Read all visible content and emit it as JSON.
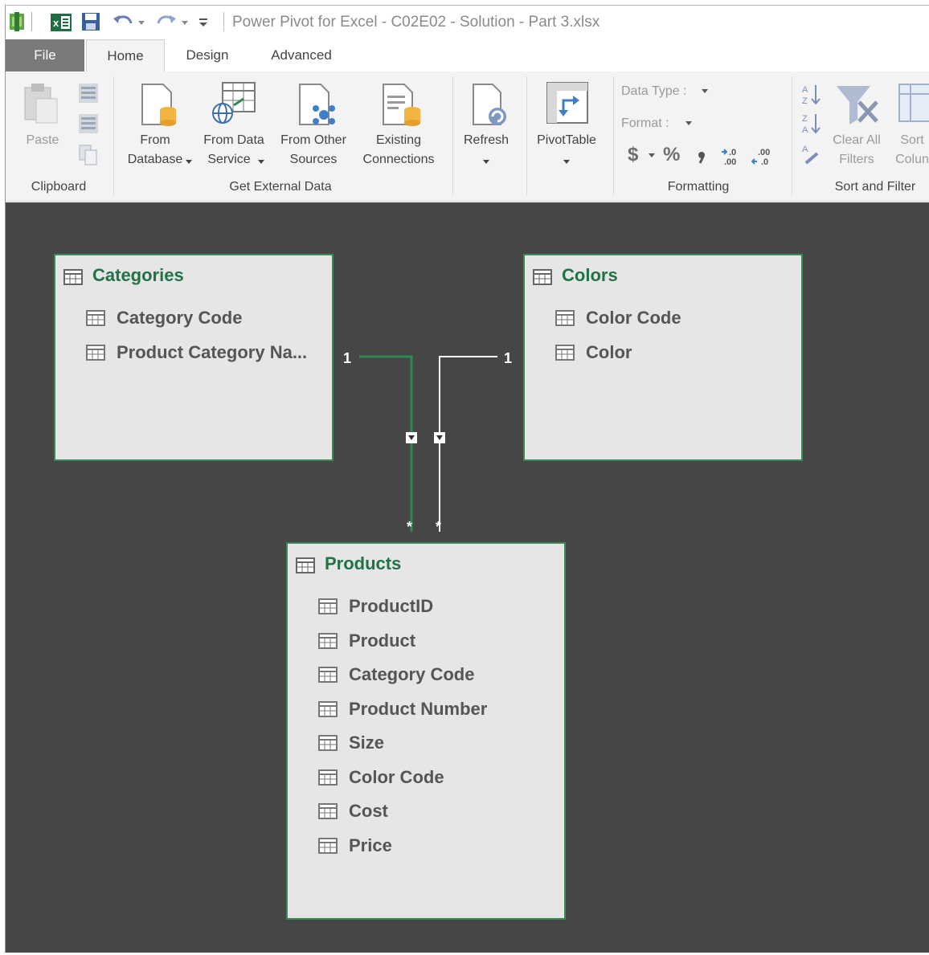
{
  "window": {
    "title": "Power Pivot for Excel - C02E02 - Solution - Part 3.xlsx"
  },
  "tabs": {
    "file": "File",
    "home": "Home",
    "design": "Design",
    "advanced": "Advanced"
  },
  "ribbon": {
    "clipboard": {
      "paste": "Paste",
      "label": "Clipboard"
    },
    "get_external_data": {
      "from_database_l1": "From",
      "from_database_l2": "Database",
      "from_data_service_l1": "From Data",
      "from_data_service_l2": "Service",
      "from_other_sources_l1": "From Other",
      "from_other_sources_l2": "Sources",
      "existing_connections_l1": "Existing",
      "existing_connections_l2": "Connections",
      "label": "Get External Data"
    },
    "refresh": "Refresh",
    "pivot_table": "PivotTable",
    "formatting": {
      "data_type": "Data Type :",
      "format": "Format :",
      "currency": "$",
      "percent": "%",
      "comma": "ʕ",
      "label": "Formatting"
    },
    "sort_filter": {
      "clear_all_l1": "Clear All",
      "clear_all_l2": "Filters",
      "sort_column_l1": "Sort",
      "sort_column_l2": "Colun",
      "label": "Sort and Filter"
    }
  },
  "diagram": {
    "categories": {
      "title": "Categories",
      "fields": [
        "Category Code",
        "Product Category Na..."
      ]
    },
    "colors": {
      "title": "Colors",
      "fields": [
        "Color Code",
        "Color"
      ]
    },
    "products": {
      "title": "Products",
      "fields": [
        "ProductID",
        "Product",
        "Category Code",
        "Product Number",
        "Size",
        "Color Code",
        "Cost",
        "Price"
      ]
    },
    "relationships": {
      "one_left": "1",
      "one_right": "1",
      "many_left": "*",
      "many_right": "*"
    },
    "colors_hex": {
      "canvas": "#464646",
      "card": "#e6e6e6",
      "accent_green": "#217346",
      "selected_line": "#2e8a50",
      "line": "#ffffff"
    }
  }
}
